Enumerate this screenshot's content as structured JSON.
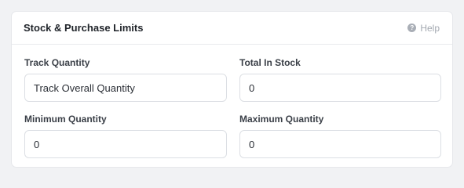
{
  "panel": {
    "title": "Stock & Purchase Limits",
    "help_label": "Help",
    "help_icon": "question-circle-icon"
  },
  "fields": {
    "track_quantity": {
      "label": "Track Quantity",
      "value": "Track Overall Quantity"
    },
    "total_in_stock": {
      "label": "Total In Stock",
      "value": "0"
    },
    "minimum_quantity": {
      "label": "Minimum Quantity",
      "value": "0"
    },
    "maximum_quantity": {
      "label": "Maximum Quantity",
      "value": "0"
    }
  }
}
